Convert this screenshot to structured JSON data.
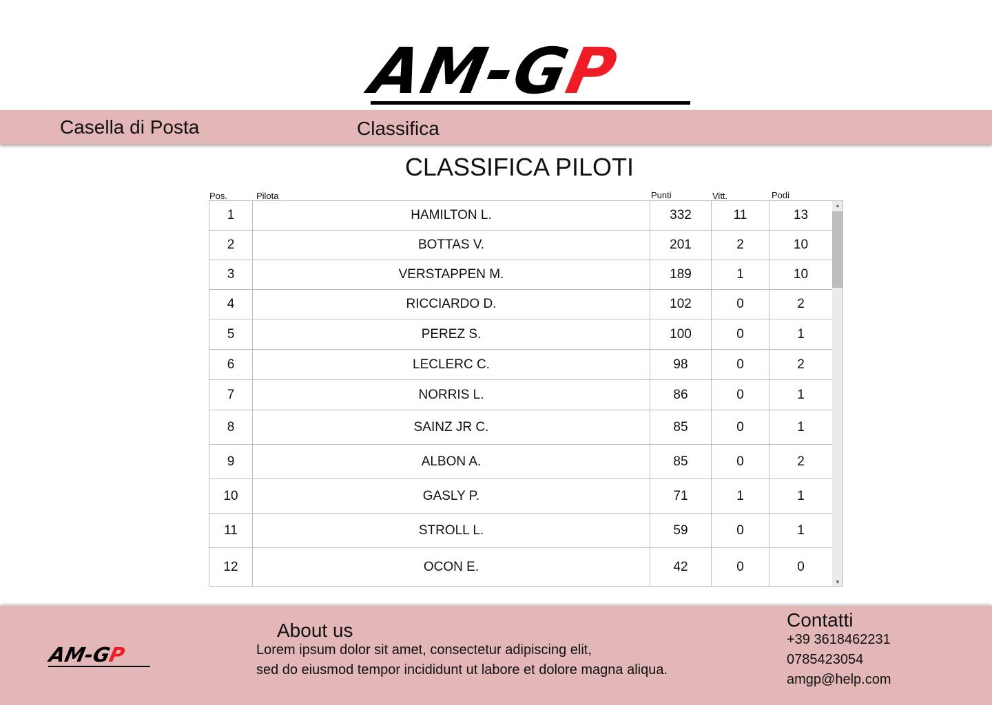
{
  "logo": {
    "part_black": "AM-G",
    "part_red": "P"
  },
  "nav": {
    "mailbox": "Casella di Posta",
    "standings": "Classifica"
  },
  "page_title": "CLASSIFICA PILOTI",
  "table": {
    "headers": {
      "pos": "Pos.",
      "driver": "Pilota",
      "points": "Punti",
      "wins": "Vitt.",
      "podiums": "Podi"
    },
    "rows": [
      {
        "pos": "1",
        "driver": "HAMILTON L.",
        "points": "332",
        "wins": "11",
        "podiums": "13"
      },
      {
        "pos": "2",
        "driver": "BOTTAS V.",
        "points": "201",
        "wins": "2",
        "podiums": "10"
      },
      {
        "pos": "3",
        "driver": "VERSTAPPEN M.",
        "points": "189",
        "wins": "1",
        "podiums": "10"
      },
      {
        "pos": "4",
        "driver": "RICCIARDO D.",
        "points": "102",
        "wins": "0",
        "podiums": "2"
      },
      {
        "pos": "5",
        "driver": "PEREZ S.",
        "points": "100",
        "wins": "0",
        "podiums": "1"
      },
      {
        "pos": "6",
        "driver": "LECLERC C.",
        "points": "98",
        "wins": "0",
        "podiums": "2"
      },
      {
        "pos": "7",
        "driver": "NORRIS L.",
        "points": "86",
        "wins": "0",
        "podiums": "1"
      },
      {
        "pos": "8",
        "driver": "SAINZ JR C.",
        "points": "85",
        "wins": "0",
        "podiums": "1"
      },
      {
        "pos": "9",
        "driver": "ALBON A.",
        "points": "85",
        "wins": "0",
        "podiums": "2"
      },
      {
        "pos": "10",
        "driver": "GASLY P.",
        "points": "71",
        "wins": "1",
        "podiums": "1"
      },
      {
        "pos": "11",
        "driver": "STROLL L.",
        "points": "59",
        "wins": "0",
        "podiums": "1"
      },
      {
        "pos": "12",
        "driver": "OCON E.",
        "points": "42",
        "wins": "0",
        "podiums": "0"
      }
    ]
  },
  "footer": {
    "logo": {
      "part_black": "AM-G",
      "part_red": "P"
    },
    "about_title": "About us",
    "about_line1": "Lorem ipsum dolor sit amet, consectetur adipiscing elit,",
    "about_line2": "sed do eiusmod  tempor incididunt ut labore et dolore magna aliqua.",
    "contacts_title": "Contatti",
    "phone1": "+39 3618462231",
    "phone2": "0785423054",
    "email": "amgp@help.com"
  },
  "colors": {
    "bar": "#e3b7b8",
    "logo_red": "#ee1c25"
  },
  "icons": {
    "scroll_up": "scroll-up-arrow-icon",
    "scroll_down": "scroll-down-arrow-icon"
  }
}
